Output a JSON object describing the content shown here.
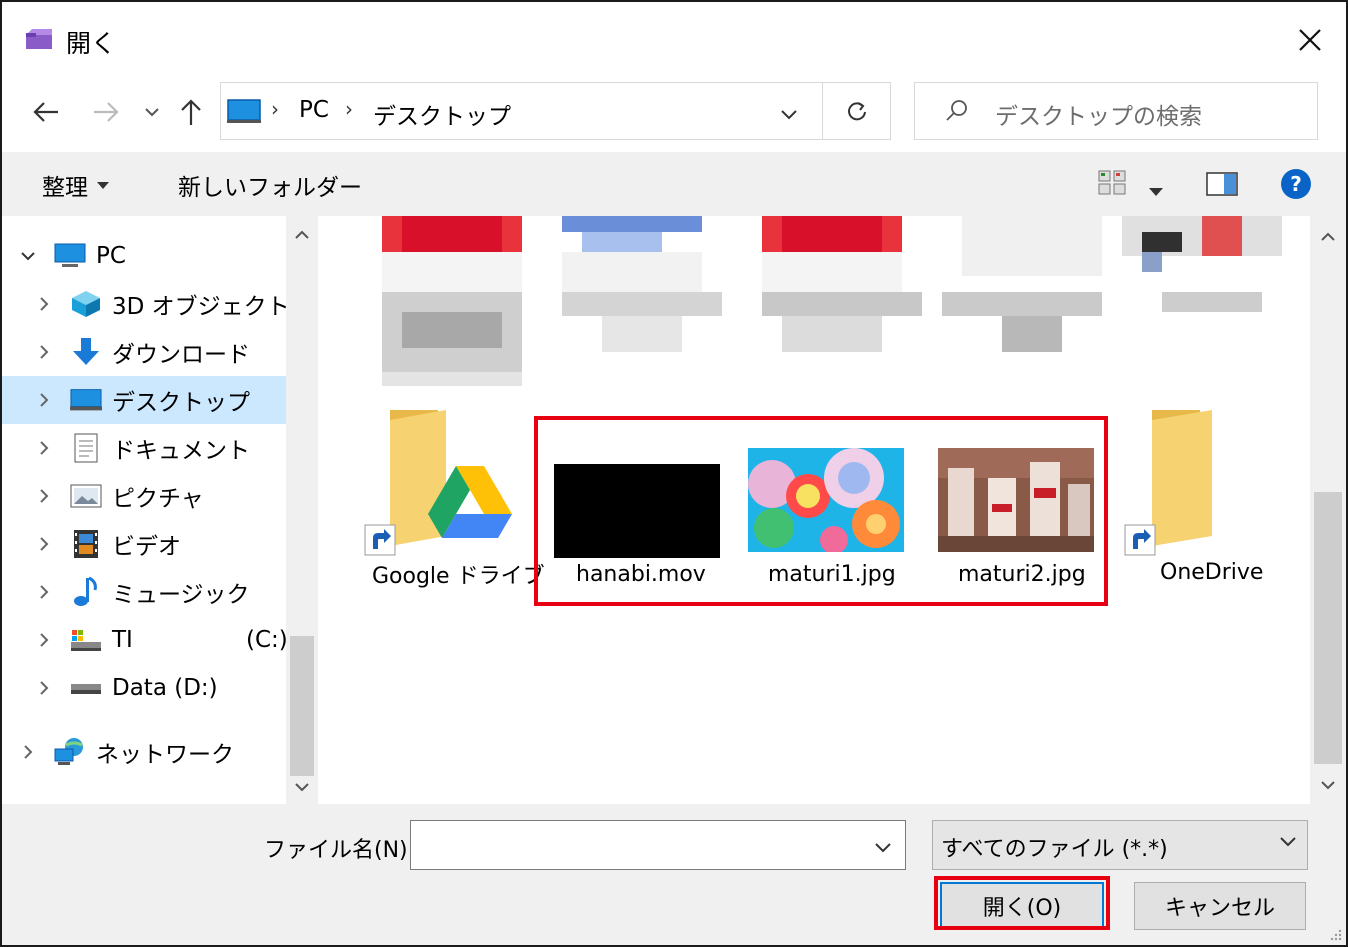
{
  "window": {
    "title": "開く"
  },
  "address": {
    "segments": [
      "PC",
      "デスクトップ"
    ],
    "search_placeholder": "デスクトップの検索"
  },
  "toolbar": {
    "organize": "整理",
    "new_folder": "新しいフォルダー"
  },
  "nav": {
    "items": [
      {
        "label": "PC",
        "icon": "pc-icon",
        "expanded": true
      },
      {
        "label": "3D オブジェクト",
        "icon": "3d-objects-icon"
      },
      {
        "label": "ダウンロード",
        "icon": "download-icon"
      },
      {
        "label": "デスクトップ",
        "icon": "desktop-icon",
        "selected": true
      },
      {
        "label": "ドキュメント",
        "icon": "document-icon"
      },
      {
        "label": "ピクチャ",
        "icon": "picture-icon"
      },
      {
        "label": "ビデオ",
        "icon": "video-icon"
      },
      {
        "label": "ミュージック",
        "icon": "music-icon"
      },
      {
        "label": "TI",
        "drive": "(C:)",
        "icon": "drive-c-icon"
      },
      {
        "label": "Data (D:)",
        "icon": "drive-d-icon"
      },
      {
        "label": "ネットワーク",
        "icon": "network-icon"
      }
    ]
  },
  "files": [
    {
      "label": "Google ドライブ",
      "type": "shortcut-folder",
      "icon": "google-drive-icon"
    },
    {
      "label": "hanabi.mov",
      "type": "video"
    },
    {
      "label": "maturi1.jpg",
      "type": "image"
    },
    {
      "label": "maturi2.jpg",
      "type": "image"
    },
    {
      "label": "OneDrive",
      "type": "shortcut-folder"
    }
  ],
  "bottom": {
    "filename_label": "ファイル名(N):",
    "filename_value": "",
    "filetype": "すべてのファイル (*.*)",
    "open_button": "開く(O)",
    "cancel_button": "キャンセル"
  },
  "colors": {
    "highlight": "#e60012",
    "selection": "#cce8ff",
    "accent": "#0078d7"
  }
}
